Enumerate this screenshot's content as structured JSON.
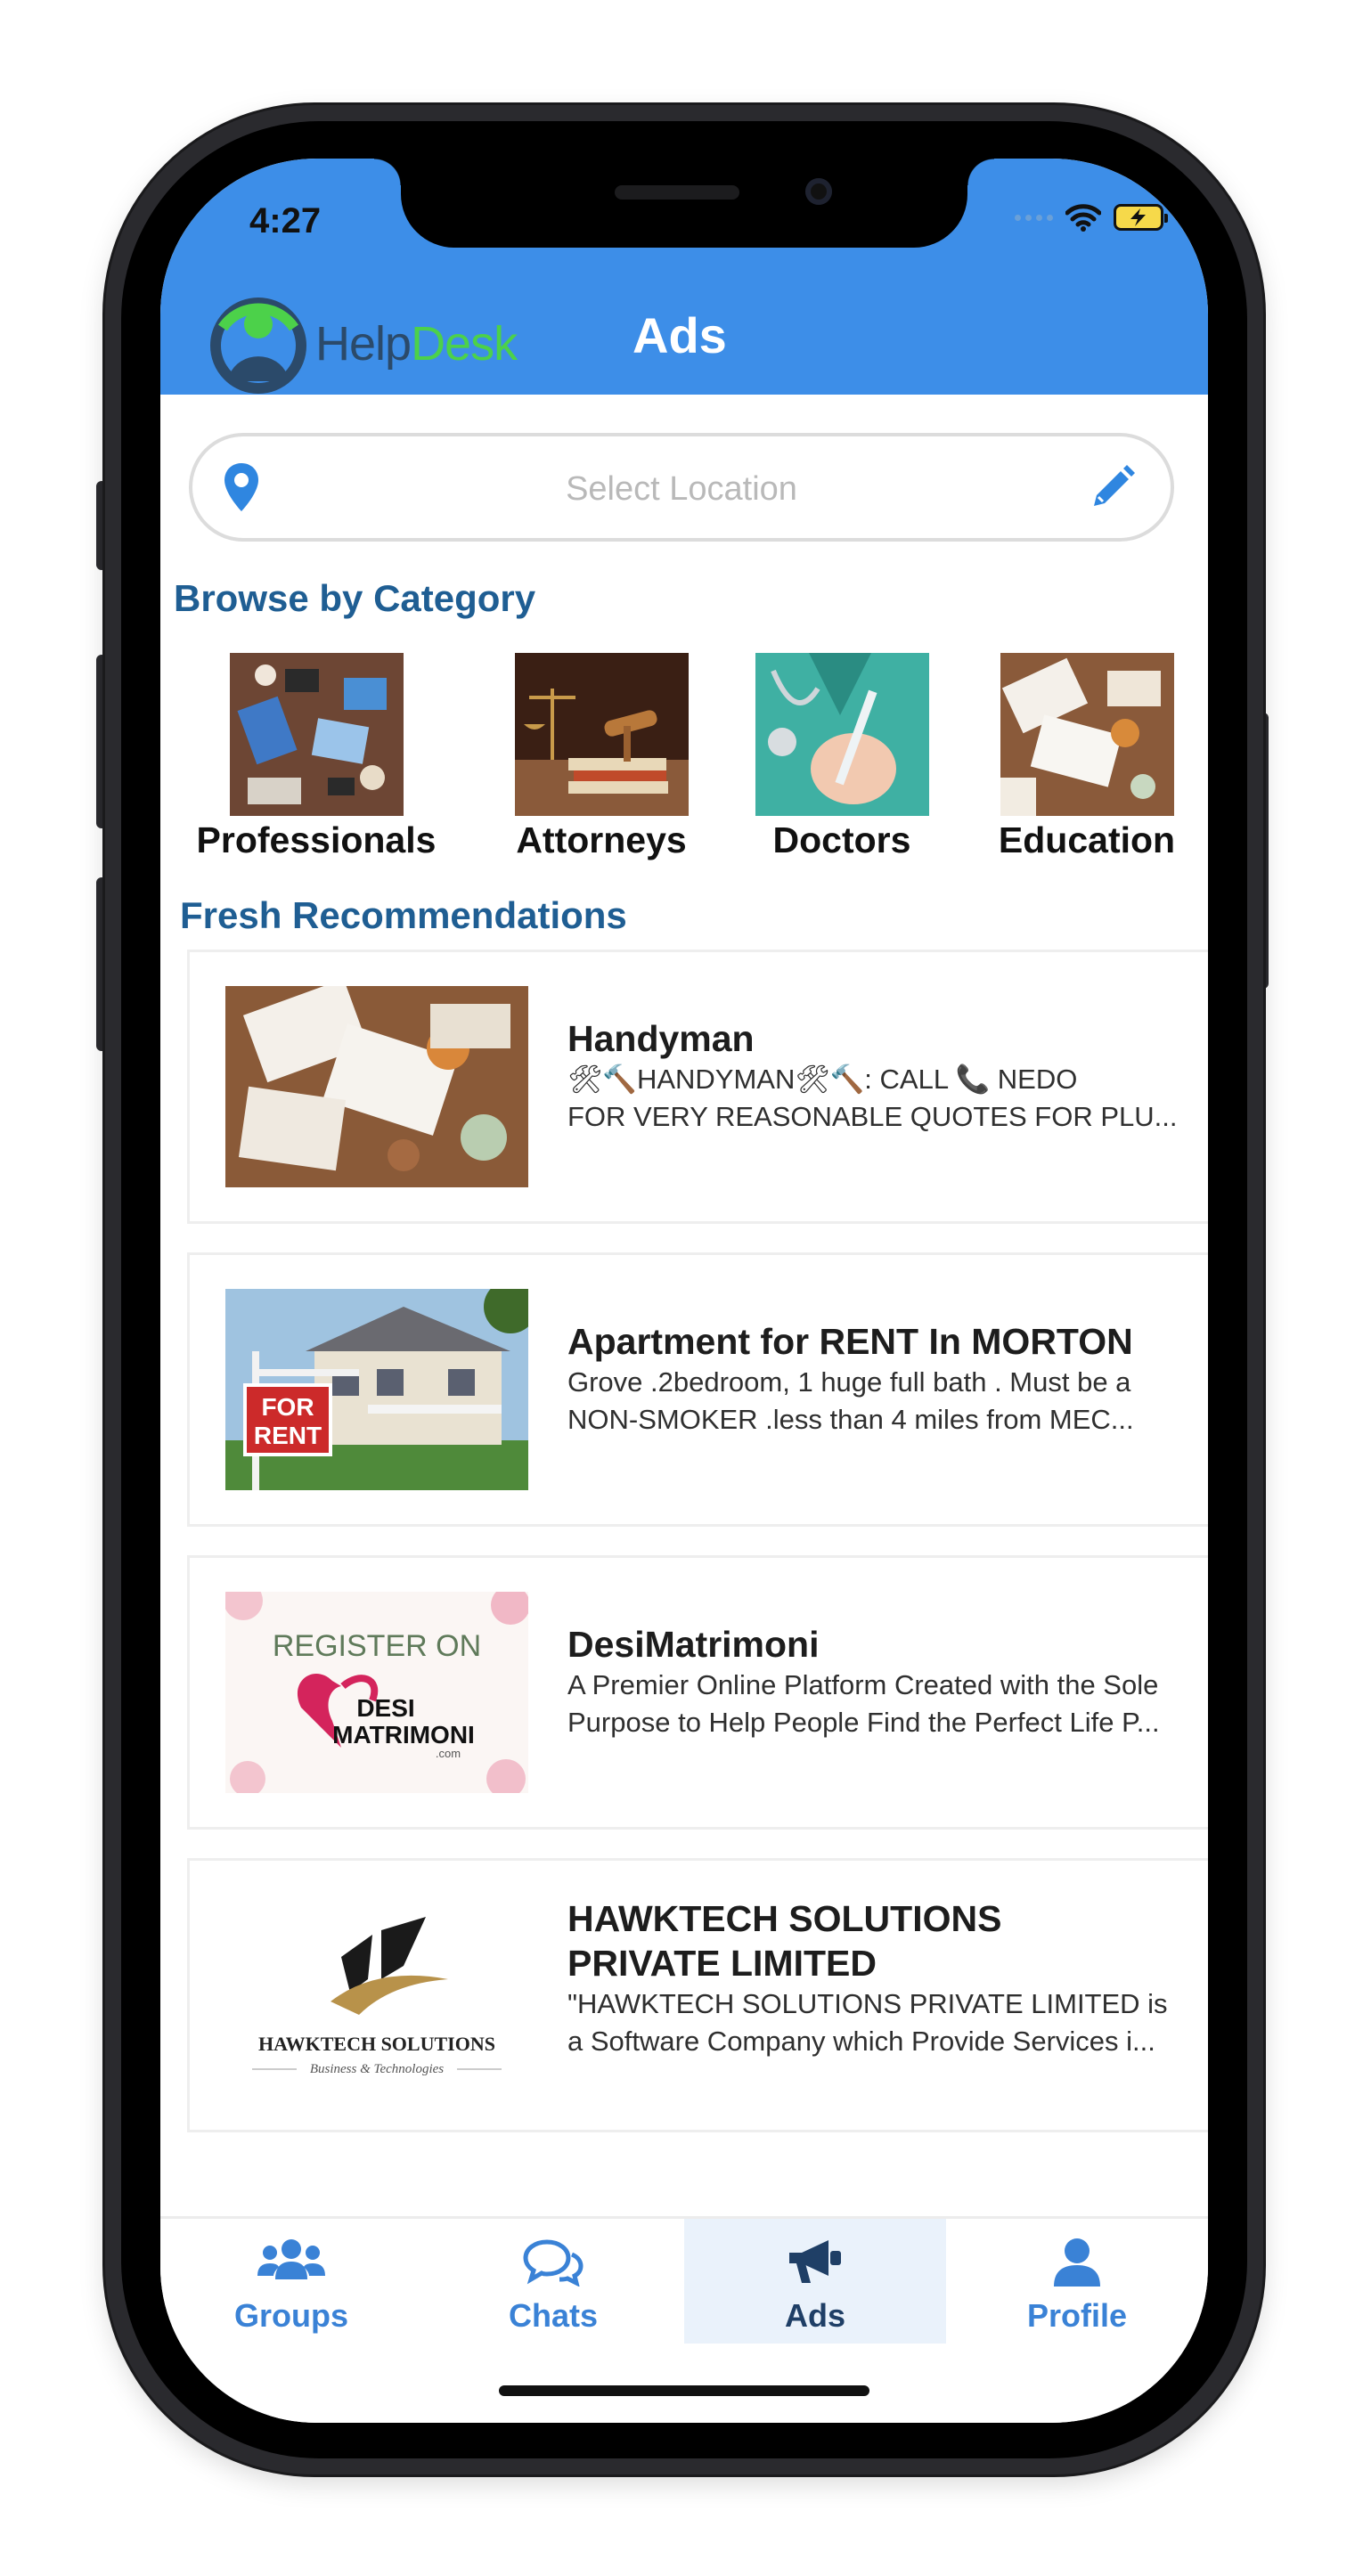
{
  "status_bar": {
    "time": "4:27"
  },
  "header": {
    "logo_help": "Help",
    "logo_desk": "Desk",
    "title": "Ads",
    "bg_color": "#3d8ee8"
  },
  "location": {
    "placeholder": "Select Location"
  },
  "browse": {
    "title": "Browse by Category",
    "categories": [
      {
        "label": "Professionals"
      },
      {
        "label": "Attorneys"
      },
      {
        "label": "Doctors"
      },
      {
        "label": "Education"
      }
    ]
  },
  "recommendations": {
    "title": "Fresh Recommendations",
    "items": [
      {
        "title_line1": "Handyman",
        "title_line2": "",
        "desc_line1": "🛠🔨HANDYMAN🛠🔨: CALL 📞 NEDO",
        "desc_line2": "FOR VERY REASONABLE QUOTES FOR  PLU..."
      },
      {
        "title_line1": "Apartment for RENT In MORTON",
        "title_line2": "",
        "desc_line1": "Grove .2bedroom, 1 huge full bath . Must be a",
        "desc_line2": "NON-SMOKER .less than 4 miles from MEC...",
        "sign_line1": "FOR",
        "sign_line2": "RENT"
      },
      {
        "title_line1": "DesiMatrimoni",
        "title_line2": "",
        "desc_line1": "A Premier Online Platform Created with the Sole",
        "desc_line2": "Purpose to Help People Find the Perfect Life P...",
        "banner_top": "REGISTER ON",
        "banner_brand1": "DESI",
        "banner_brand2": "MATRIMONI",
        "banner_domain": ".com"
      },
      {
        "title_line1": "HAWKTECH SOLUTIONS",
        "title_line2": "PRIVATE LIMITED",
        "desc_line1": "\"HAWKTECH SOLUTIONS PRIVATE LIMITED is",
        "desc_line2": "a Software Company which Provide Services i...",
        "logo_name": "HAWKTECH SOLUTIONS",
        "logo_tagline": "Business & Technologies"
      }
    ]
  },
  "tabs": [
    {
      "label": "Groups",
      "icon": "groups-icon",
      "active": false
    },
    {
      "label": "Chats",
      "icon": "chats-icon",
      "active": false
    },
    {
      "label": "Ads",
      "icon": "megaphone-icon",
      "active": true
    },
    {
      "label": "Profile",
      "icon": "profile-icon",
      "active": false
    }
  ],
  "colors": {
    "accent": "#3a82d6",
    "section_title": "#1f5e93",
    "active_tab_bg": "#eaf2fb"
  }
}
